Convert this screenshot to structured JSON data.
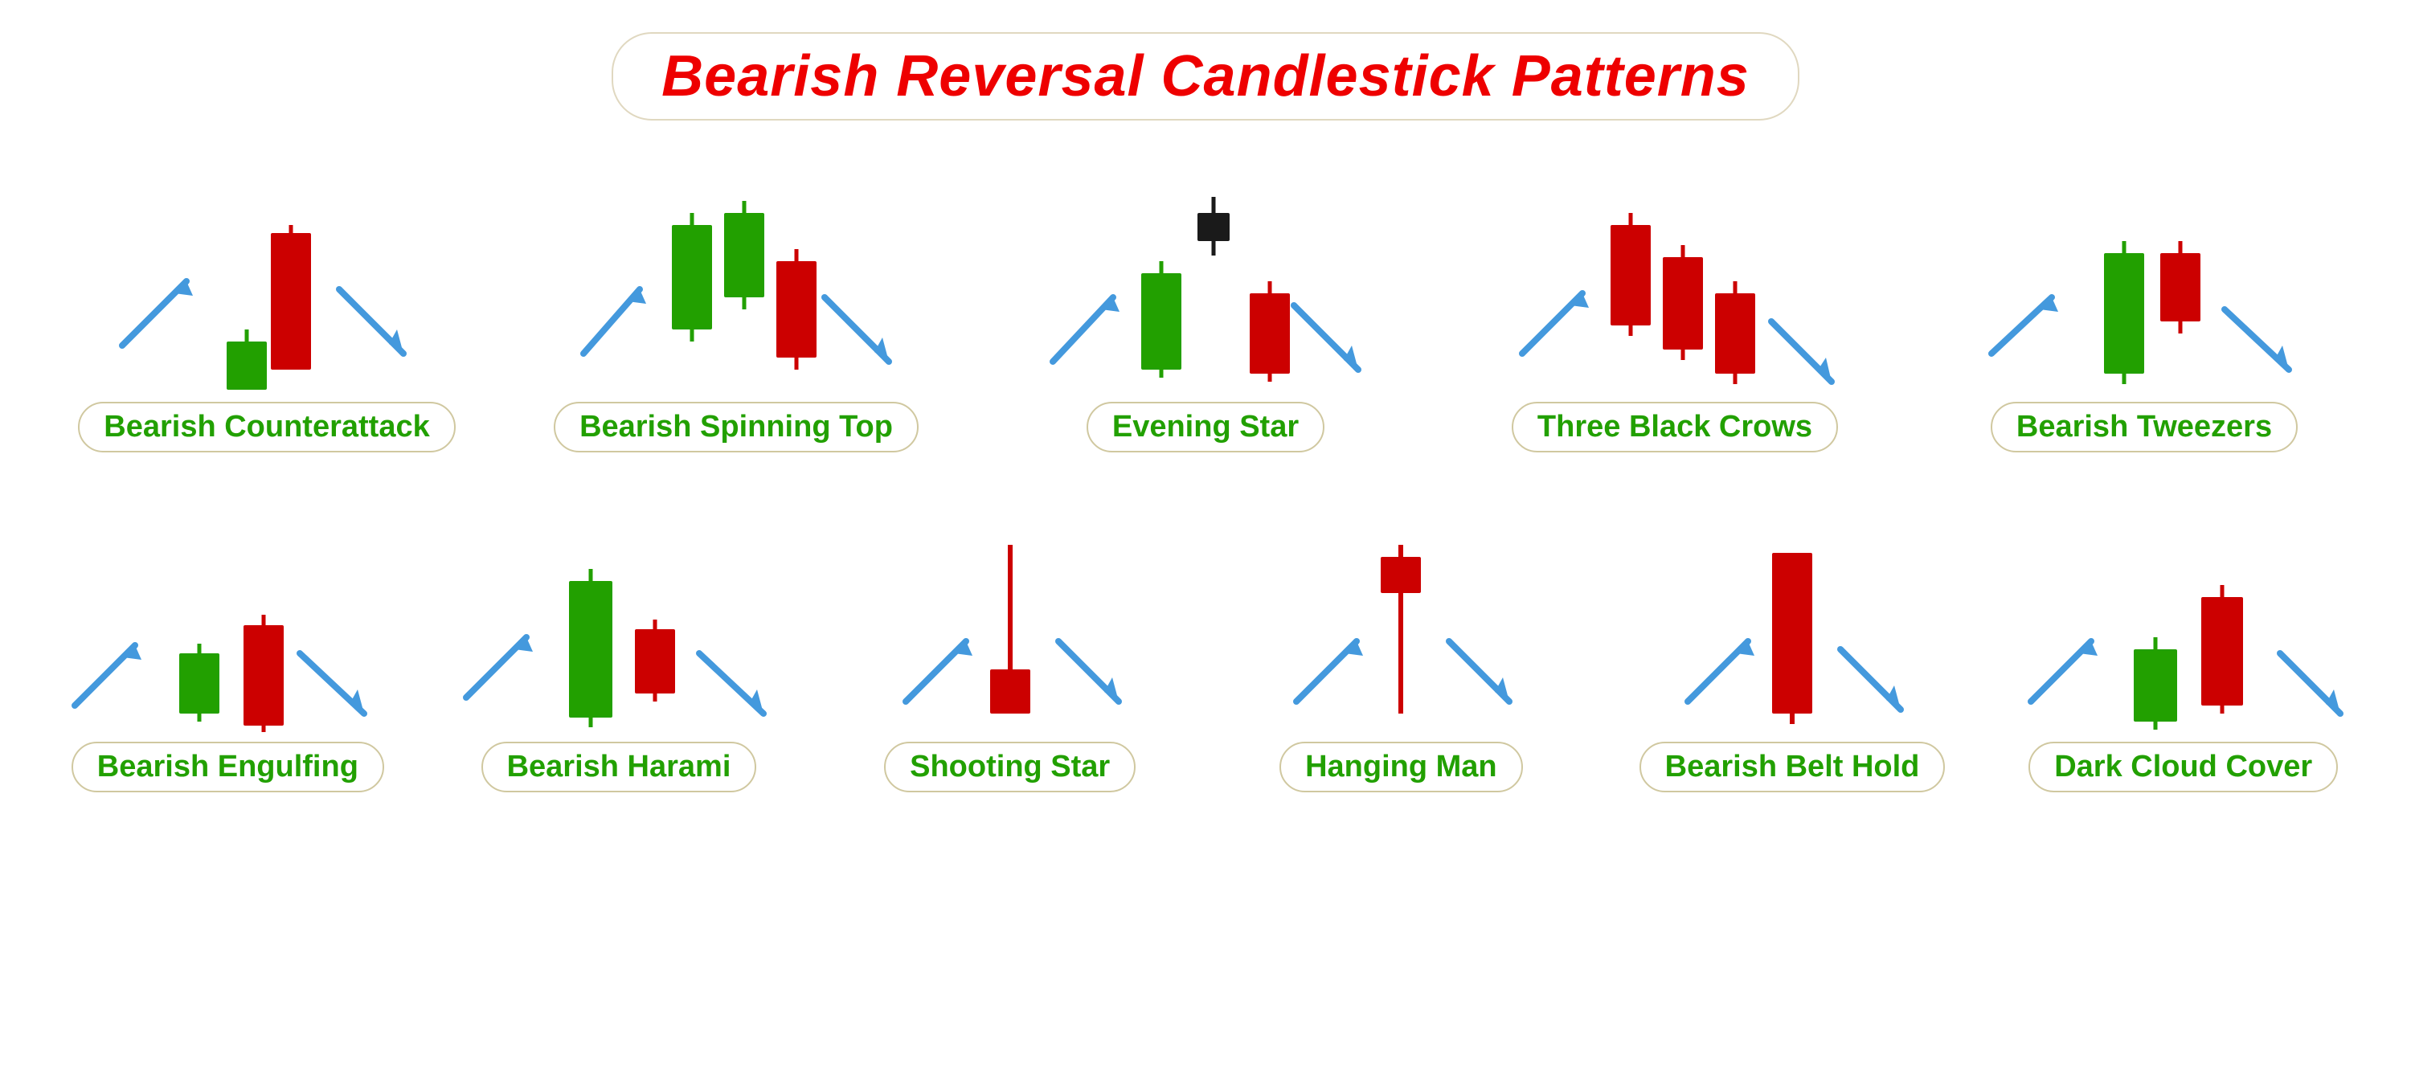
{
  "title": "Bearish Reversal Candlestick Patterns",
  "patterns": {
    "row1": [
      {
        "label": "Bearish\nCounterattack"
      },
      {
        "label": "Bearish Spinning Top"
      },
      {
        "label": "Evening Star"
      },
      {
        "label": "Three Black Crows"
      },
      {
        "label": "Bearish Tweezers"
      }
    ],
    "row2": [
      {
        "label": "Bearish Engulfing"
      },
      {
        "label": "Bearish Harami"
      },
      {
        "label": "Shooting Star"
      },
      {
        "label": "Hanging Man"
      },
      {
        "label": "Bearish Belt Hold"
      },
      {
        "label": "Dark Cloud Cover"
      }
    ]
  }
}
